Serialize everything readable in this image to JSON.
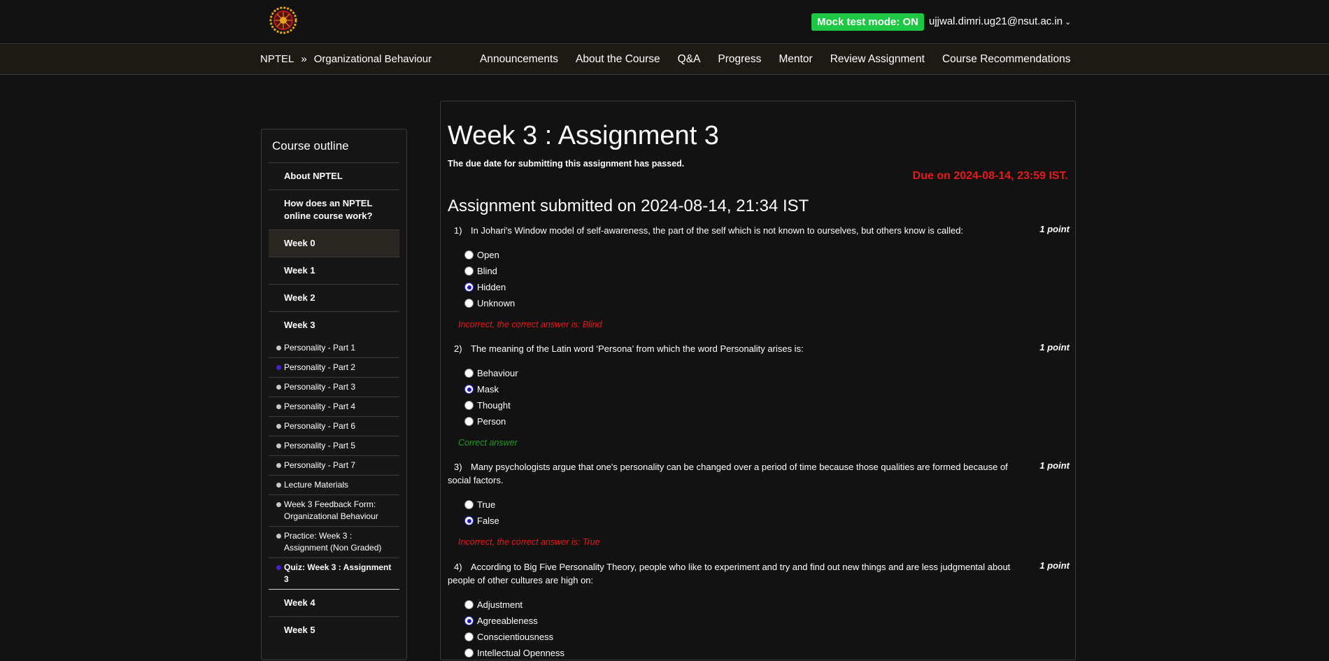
{
  "header": {
    "mock_badge": "Mock test mode: ON",
    "user_email": "ujjwal.dimri.ug21@nsut.ac.in"
  },
  "breadcrumb": {
    "root": "NPTEL",
    "separator": "»",
    "course": "Organizational Behaviour"
  },
  "nav": [
    "Announcements",
    "About the Course",
    "Q&A",
    "Progress",
    "Mentor",
    "Review Assignment",
    "Course Recommendations"
  ],
  "sidebar": {
    "title": "Course outline",
    "items": [
      {
        "label": "About NPTEL"
      },
      {
        "label": "How does an NPTEL online course work?"
      },
      {
        "label": "Week 0"
      },
      {
        "label": "Week 1"
      },
      {
        "label": "Week 2"
      },
      {
        "label": "Week 3"
      },
      {
        "label": "Week 4"
      },
      {
        "label": "Week 5"
      }
    ],
    "week3_items": [
      {
        "label": "Personality - Part 1"
      },
      {
        "label": "Personality - Part 2"
      },
      {
        "label": "Personality - Part 3"
      },
      {
        "label": "Personality - Part 4"
      },
      {
        "label": "Personality - Part 6"
      },
      {
        "label": "Personality - Part 5"
      },
      {
        "label": "Personality - Part 7"
      },
      {
        "label": "Lecture Materials"
      },
      {
        "label": "Week 3 Feedback Form: Organizational Behaviour"
      },
      {
        "label": "Practice: Week 3 : Assignment (Non Graded)"
      },
      {
        "label": "Quiz: Week 3 : Assignment 3"
      }
    ]
  },
  "main": {
    "title": "Week 3 : Assignment 3",
    "due_passed": "The due date for submitting this assignment has passed.",
    "due_date": "Due on 2024-08-14, 23:59 IST.",
    "submitted": "Assignment submitted on 2024-08-14, 21:34 IST",
    "questions": [
      {
        "num": "1)",
        "text": "In Johari's Window model of self-awareness, the part of the self which is not known to ourselves, but others know is called:",
        "points": "1 point",
        "options": [
          "Open",
          "Blind",
          "Hidden",
          "Unknown"
        ],
        "selected": 2,
        "feedback": "Incorrect, the correct answer is: Blind"
      },
      {
        "num": "2)",
        "text": "The meaning of the Latin word ‘Persona’ from which the word Personality arises is:",
        "points": "1 point",
        "options": [
          "Behaviour",
          "Mask",
          "Thought",
          "Person"
        ],
        "selected": 1,
        "feedback": "Correct answer"
      },
      {
        "num": "3)",
        "text": "Many psychologists argue that one's personality can be changed over a period of time because those qualities are formed because of social factors.",
        "points": "1 point",
        "options": [
          "True",
          "False"
        ],
        "selected": 1,
        "feedback": "Incorrect, the correct answer is: True"
      },
      {
        "num": "4)",
        "text": "According to Big Five Personality Theory, people who like to experiment and try and find out new things and are less judgmental about people of other cultures are high on:",
        "points": "1 point",
        "options": [
          "Adjustment",
          "Agreeableness",
          "Conscientiousness",
          "Intellectual Openness"
        ],
        "selected": 1
      }
    ]
  }
}
